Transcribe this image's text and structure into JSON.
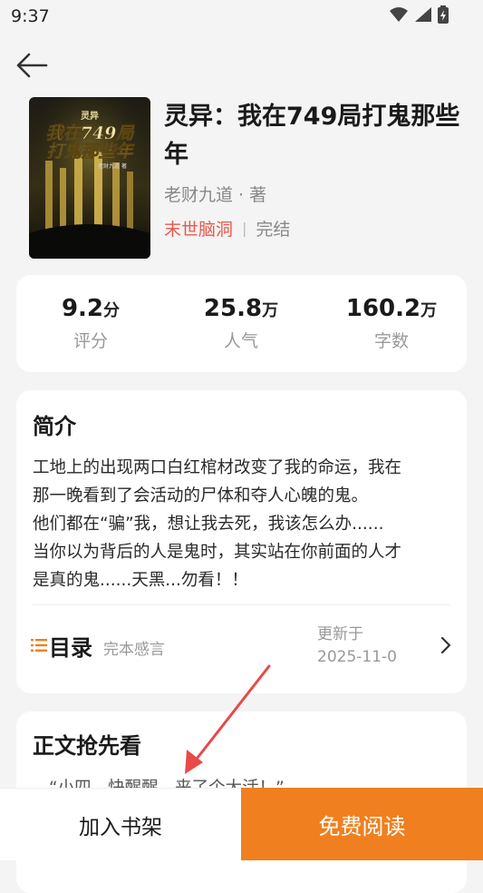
{
  "status_bar": {
    "time": "9:37",
    "icons": [
      "wifi-icon",
      "signal-icon",
      "battery-charging-icon"
    ]
  },
  "header": {
    "back_icon": "arrow-left-icon"
  },
  "book": {
    "cover_texts": {
      "tag": "灵异",
      "line1": "我在749局",
      "line2": "打鬼那些年",
      "author": "老财九道 著"
    },
    "title": "灵异：我在749局打鬼那些年",
    "author_line": "老财九道 · 著",
    "genre": "末世脑洞",
    "separator": "|",
    "status": "完结"
  },
  "stats": [
    {
      "value": "9.2",
      "unit": "分",
      "label": "评分"
    },
    {
      "value": "25.8",
      "unit": "万",
      "label": "人气"
    },
    {
      "value": "160.2",
      "unit": "万",
      "label": "字数"
    }
  ],
  "intro": {
    "title": "简介",
    "lines": [
      "工地上的出现两口白红棺材改变了我的命运，我在",
      "那一晚看到了会活动的尸体和夺人心魄的鬼。",
      "他们都在“骗”我，想让我去死，我该怎么办......",
      "当你以为背后的人是鬼时，其实站在你前面的人才",
      "是真的鬼......天黑...勿看！！"
    ]
  },
  "toc": {
    "title": "目录",
    "latest": "完本感言",
    "update_line1": "更新于",
    "update_line2": "2025-11-0"
  },
  "preview": {
    "title": "正文抢先看",
    "text": "“小四，快醒醒，来了个大活！”"
  },
  "bottom": {
    "shelf_label": "加入书架",
    "read_label": "免费阅读"
  },
  "colors": {
    "accent": "#f07f1f",
    "genre": "#e8584e",
    "arrow": "#e84a4a"
  }
}
